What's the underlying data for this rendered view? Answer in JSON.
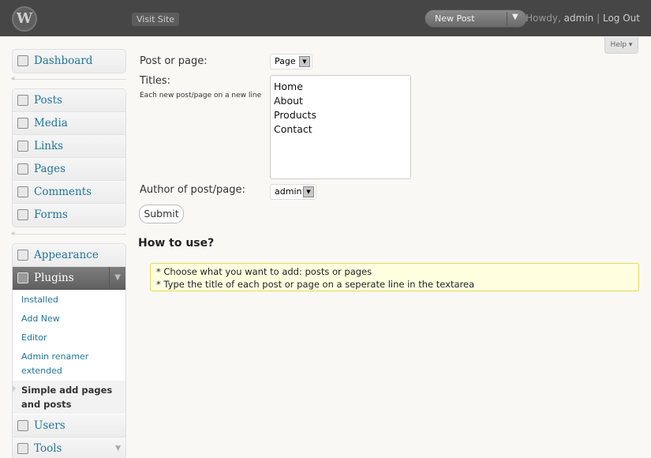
{
  "header": {
    "logo_letter": "W",
    "visit_site": "Visit Site",
    "new_post": "New Post",
    "howdy_prefix": "Howdy,",
    "user": "admin",
    "divider": "|",
    "logout": "Log Out"
  },
  "help": {
    "label": "Help ▾"
  },
  "sidebar": {
    "dashboard": "Dashboard",
    "posts": "Posts",
    "media": "Media",
    "links": "Links",
    "pages": "Pages",
    "comments": "Comments",
    "forms": "Forms",
    "appearance": "Appearance",
    "plugins": "Plugins",
    "plugins_submenu": [
      "Installed",
      "Add New",
      "Editor",
      "Admin renamer extended",
      "Simple add pages and posts"
    ],
    "users": "Users",
    "tools": "Tools",
    "collapse_glyph": "«"
  },
  "form": {
    "type_label": "Post or page:",
    "type_value": "Page",
    "titles_label": "Titles:",
    "titles_hint": "Each new post/page on a new line",
    "titles": [
      "Home",
      "About",
      "Products",
      "Contact"
    ],
    "author_label": "Author of post/page:",
    "author_value": "admin",
    "submit": "Submit"
  },
  "howto": {
    "heading": "How to use?",
    "lines": [
      "* Choose what you want to add: posts or pages",
      "* Type the title of each post or page on a seperate line in the textarea"
    ]
  }
}
